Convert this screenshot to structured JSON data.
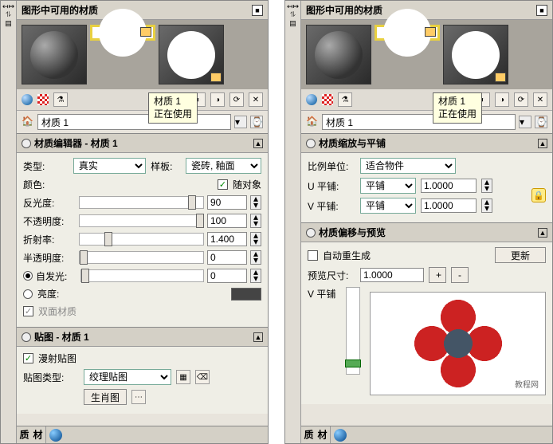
{
  "left_pane": {
    "title": "图形中可用的材质",
    "tooltip_line1": "材质 1",
    "tooltip_line2": "正在使用",
    "material_name": "材质 1",
    "editor": {
      "header": "材质编辑器 - 材质 1",
      "type_label": "类型:",
      "type_value": "真实",
      "template_label": "样板:",
      "template_value": "瓷砖, 釉面",
      "color_label": "颜色:",
      "color_opt": "随对象",
      "reflect_label": "反光度:",
      "reflect_value": "90",
      "opacity_label": "不透明度:",
      "opacity_value": "100",
      "refract_label": "折射率:",
      "refract_value": "1.400",
      "translucent_label": "半透明度:",
      "translucent_value": "0",
      "selfillum_label": "自发光:",
      "selfillum_value": "0",
      "brightness_label": "亮度:",
      "twosided_label": "双面材质"
    },
    "texture": {
      "header": "贴图 - 材质 1",
      "diffuse_label": "漫射贴图",
      "type_label": "贴图类型:",
      "type_value": "绞理贴图",
      "btn_label": "生肖图"
    },
    "side_tab": "材质"
  },
  "right_pane": {
    "title": "图形中可用的材质",
    "tooltip_line1": "材质 1",
    "tooltip_line2": "正在使用",
    "material_name": "材质 1",
    "scale": {
      "header": "材质缩放与平铺",
      "unit_label": "比例单位:",
      "unit_value": "适合物件",
      "utile_label": "U 平铺:",
      "utile_mode": "平铺",
      "utile_value": "1.0000",
      "vtile_label": "V 平铺:",
      "vtile_mode": "平铺",
      "vtile_value": "1.0000"
    },
    "offset": {
      "header": "材质偏移与预览",
      "auto_label": "自动重生成",
      "refresh_btn": "更新",
      "preview_label": "预览尺寸:",
      "preview_value": "1.0000",
      "plus": "+",
      "minus": "-",
      "vtile_label": "V 平铺"
    },
    "side_tab": "材质",
    "watermark": "教程网"
  }
}
